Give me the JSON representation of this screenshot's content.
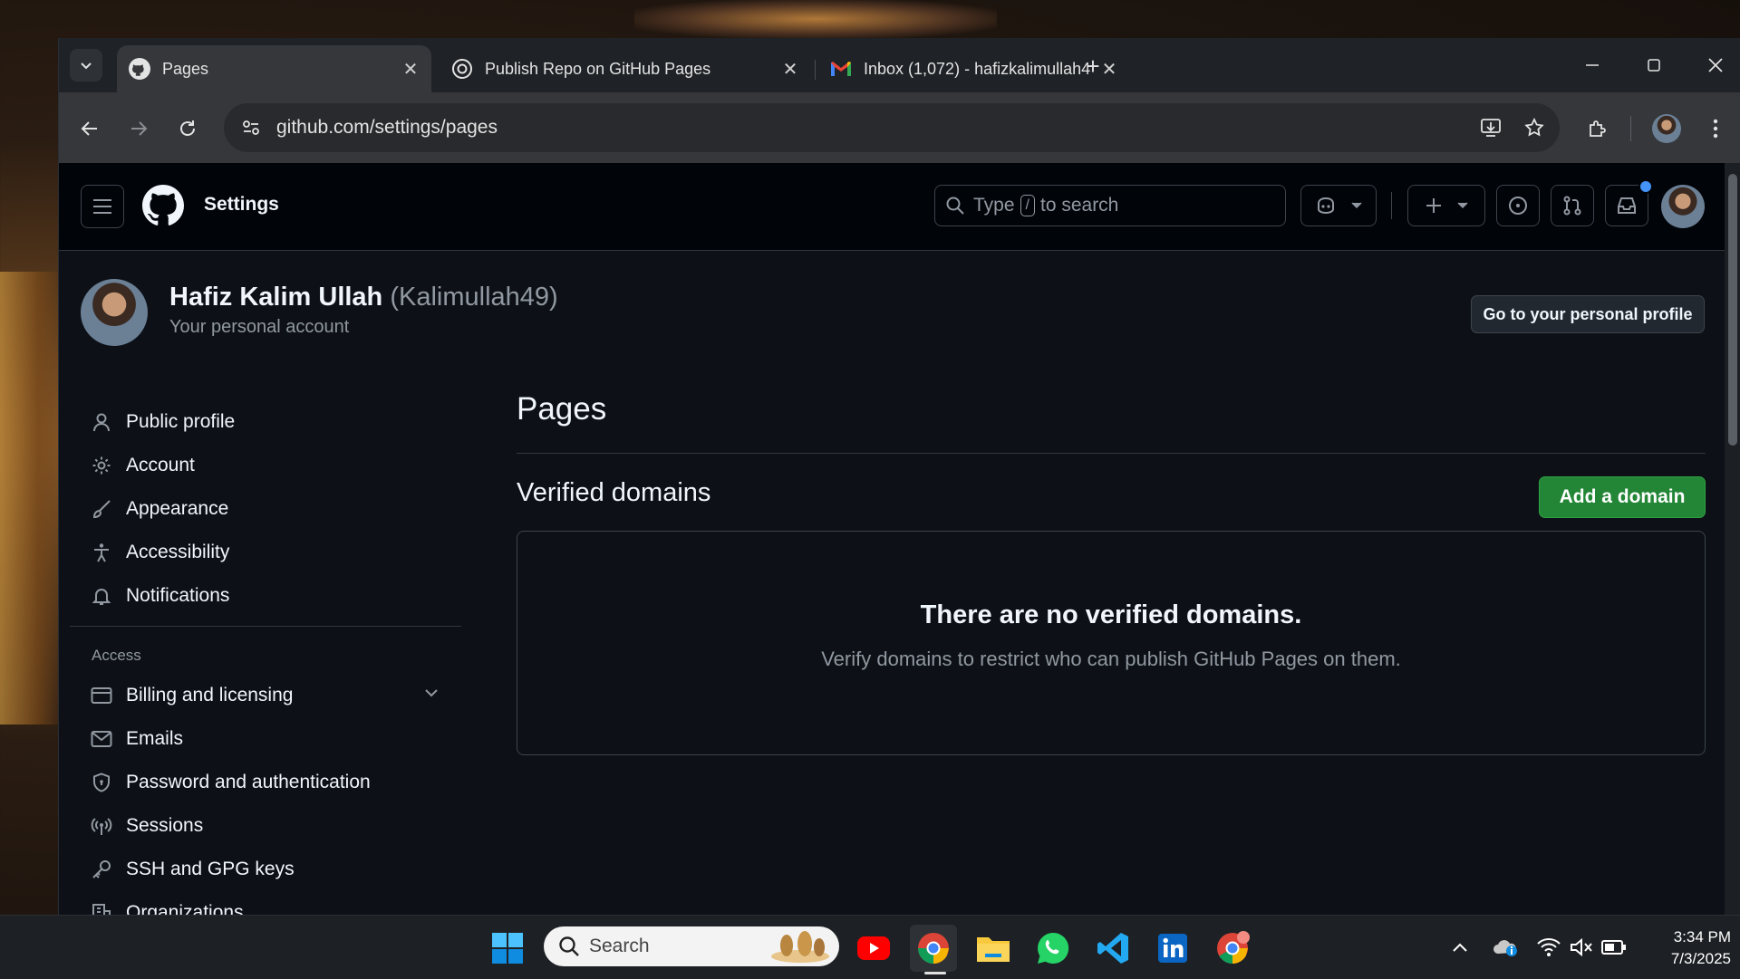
{
  "browser": {
    "tabs": [
      {
        "label": "Pages",
        "favicon": "github-icon",
        "active": true
      },
      {
        "label": "Publish Repo on GitHub Pages",
        "favicon": "openai-icon",
        "active": false
      },
      {
        "label": "Inbox (1,072) - hafizkalimullah4",
        "favicon": "gmail-icon",
        "active": false
      }
    ],
    "url": "github.com/settings/pages"
  },
  "header": {
    "context": "Settings",
    "search": {
      "prefix": "Type",
      "key": "/",
      "suffix": "to search"
    }
  },
  "profile": {
    "name": "Hafiz Kalim Ullah",
    "username": "(Kalimullah49)",
    "subtitle": "Your personal account",
    "goto_label": "Go to your personal profile"
  },
  "sidebar": {
    "items": [
      {
        "label": "Public profile",
        "icon": "person-icon"
      },
      {
        "label": "Account",
        "icon": "gear-icon"
      },
      {
        "label": "Appearance",
        "icon": "paintbrush-icon"
      },
      {
        "label": "Accessibility",
        "icon": "accessibility-icon"
      },
      {
        "label": "Notifications",
        "icon": "bell-icon"
      }
    ],
    "group_access": "Access",
    "access_items": [
      {
        "label": "Billing and licensing",
        "icon": "credit-card-icon"
      },
      {
        "label": "Emails",
        "icon": "mail-icon"
      },
      {
        "label": "Password and authentication",
        "icon": "shield-icon"
      },
      {
        "label": "Sessions",
        "icon": "broadcast-icon"
      },
      {
        "label": "SSH and GPG keys",
        "icon": "key-icon"
      },
      {
        "label": "Organizations",
        "icon": "organization-icon"
      }
    ]
  },
  "main": {
    "title": "Pages",
    "section_title": "Verified domains",
    "add_label": "Add a domain",
    "empty_title": "There are no verified domains.",
    "empty_desc": "Verify domains to restrict who can publish GitHub Pages on them."
  },
  "taskbar": {
    "search_label": "Search",
    "time": "3:34 PM",
    "date": "7/3/2025"
  },
  "colors": {
    "page_bg": "#0d1117",
    "header_bg": "#010409",
    "border": "#30363d",
    "primary_button": "#238636",
    "muted_text": "#9198a1"
  }
}
